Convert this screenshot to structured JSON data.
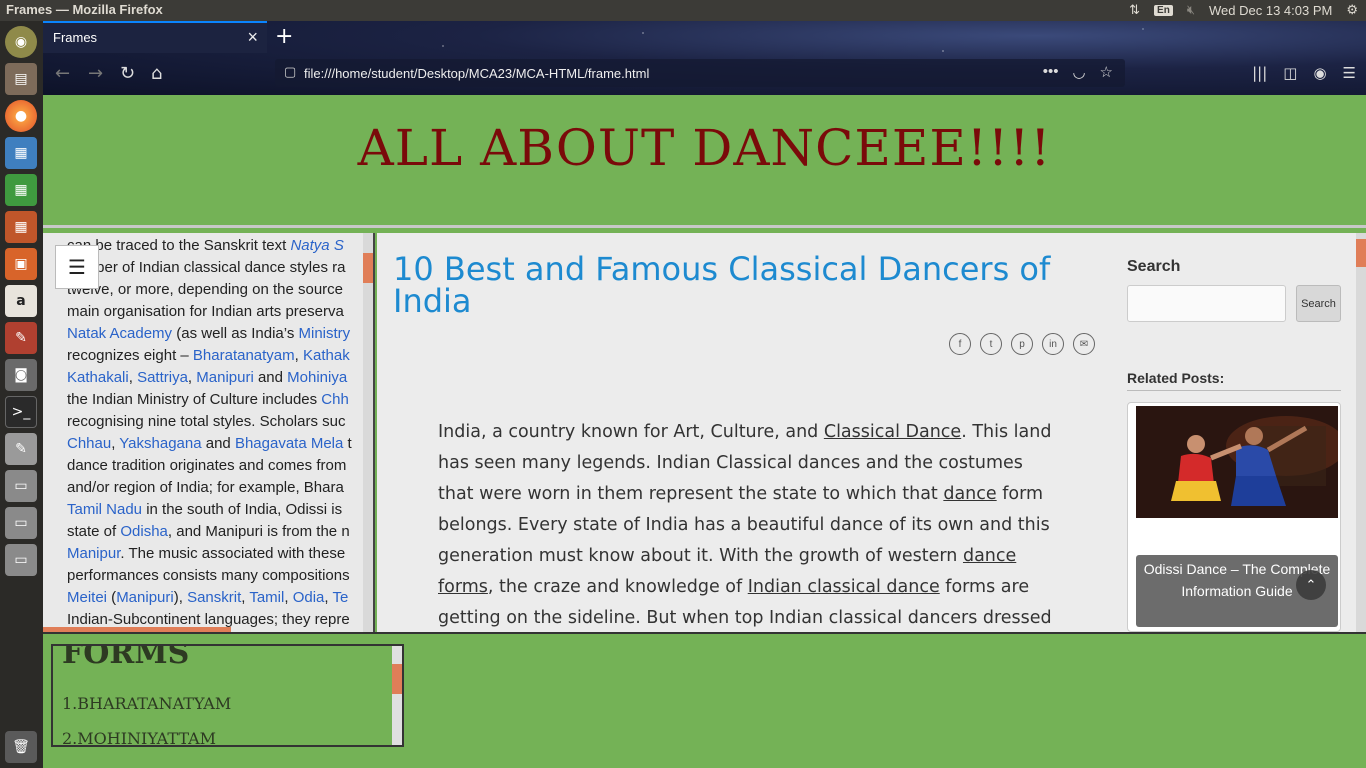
{
  "topbar": {
    "window_title": "Frames — Mozilla Firefox",
    "keyboard_layout": "En",
    "datetime": "Wed Dec 13  4:03 PM"
  },
  "browser": {
    "tab_title": "Frames",
    "url": "file:///home/student/Desktop/MCA23/MCA-HTML/frame.html"
  },
  "header": {
    "title": "ALL ABOUT DANCEEE!!!!"
  },
  "left_frame": {
    "lines": [
      [
        {
          "t": "can be traced to the Sanskrit text "
        },
        {
          "t": "Natya S",
          "link": true,
          "italic": true
        }
      ],
      [
        {
          "t": "number of Indian classical dance styles ra"
        }
      ],
      [
        {
          "t": "twelve, or more, depending on the source"
        }
      ],
      [
        {
          "t": "main organisation for Indian arts preserva"
        }
      ],
      [
        {
          "t": "Natak Academy",
          "link": true
        },
        {
          "t": " (as well as India’s "
        },
        {
          "t": "Ministry",
          "link": true
        }
      ],
      [
        {
          "t": "recognizes eight – "
        },
        {
          "t": "Bharatanatyam",
          "link": true
        },
        {
          "t": ", "
        },
        {
          "t": "Kathak",
          "link": true
        }
      ],
      [
        {
          "t": "Kathakali",
          "link": true
        },
        {
          "t": ", "
        },
        {
          "t": "Sattriya",
          "link": true
        },
        {
          "t": ", "
        },
        {
          "t": "Manipuri",
          "link": true
        },
        {
          "t": " and "
        },
        {
          "t": "Mohiniya",
          "link": true
        }
      ],
      [
        {
          "t": "the Indian Ministry of Culture includes "
        },
        {
          "t": "Chh",
          "link": true
        }
      ],
      [
        {
          "t": "recognising nine total styles. Scholars suc"
        }
      ],
      [
        {
          "t": "Chhau",
          "link": true
        },
        {
          "t": ", "
        },
        {
          "t": "Yakshagana",
          "link": true
        },
        {
          "t": " and "
        },
        {
          "t": "Bhagavata Mela",
          "link": true
        },
        {
          "t": " t"
        }
      ],
      [
        {
          "t": "dance tradition originates and comes from"
        }
      ],
      [
        {
          "t": "and/or region of India; for example, Bhara"
        }
      ],
      [
        {
          "t": "Tamil Nadu",
          "link": true
        },
        {
          "t": " in the south of India, Odissi is "
        }
      ],
      [
        {
          "t": "state of "
        },
        {
          "t": "Odisha",
          "link": true
        },
        {
          "t": ", and Manipuri is from the n"
        }
      ],
      [
        {
          "t": "Manipur",
          "link": true
        },
        {
          "t": ". The music associated with these"
        }
      ],
      [
        {
          "t": "performances consists many compositions"
        }
      ],
      [
        {
          "t": "Meitei",
          "link": true
        },
        {
          "t": " ("
        },
        {
          "t": "Manipuri",
          "link": true
        },
        {
          "t": "), "
        },
        {
          "t": "Sanskrit",
          "link": true
        },
        {
          "t": ", "
        },
        {
          "t": "Tamil",
          "link": true
        },
        {
          "t": ", "
        },
        {
          "t": "Odia",
          "link": true
        },
        {
          "t": ", "
        },
        {
          "t": "Te",
          "link": true
        }
      ],
      [
        {
          "t": "Indian-Subcontinent languages; they repre"
        }
      ]
    ]
  },
  "main": {
    "title": "10 Best and Famous Classical Dancers of India",
    "share_icons": [
      "f",
      "t",
      "p",
      "in",
      "✉"
    ],
    "article_segments": [
      {
        "t": "India, a country known for Art, Culture, and "
      },
      {
        "t": "Classical Dance",
        "u": true
      },
      {
        "t": ". This land has seen many legends. Indian Classical dances and the costumes that were worn in them represent the state to which that "
      },
      {
        "t": "dance",
        "u": true
      },
      {
        "t": " form belongs. Every state of India has a beautiful dance of its own and this generation must know about it. With the growth of western "
      },
      {
        "t": "dance forms",
        "u": true
      },
      {
        "t": ", the craze and knowledge of "
      },
      {
        "t": "Indian classical dance",
        "u": true
      },
      {
        "t": " forms are getting on the sideline. But when top Indian classical dancers dressed in traditional attire step on a"
      }
    ],
    "sidebar": {
      "search_heading": "Search",
      "search_button": "Search",
      "related_heading": "Related Posts:",
      "related_post_title": "Odissi Dance – The Complete Information Guide"
    }
  },
  "bottom_frame": {
    "heading": "FORMS",
    "items": [
      "1.BHARATANATYAM",
      "2.MOHINIYATTAM"
    ]
  },
  "colors": {
    "page_green": "#74b256",
    "header_title": "#7a0a0a",
    "post_title": "#1d8ad0",
    "link_blue": "#2a63c9",
    "scroll_accent": "#e07e58"
  }
}
